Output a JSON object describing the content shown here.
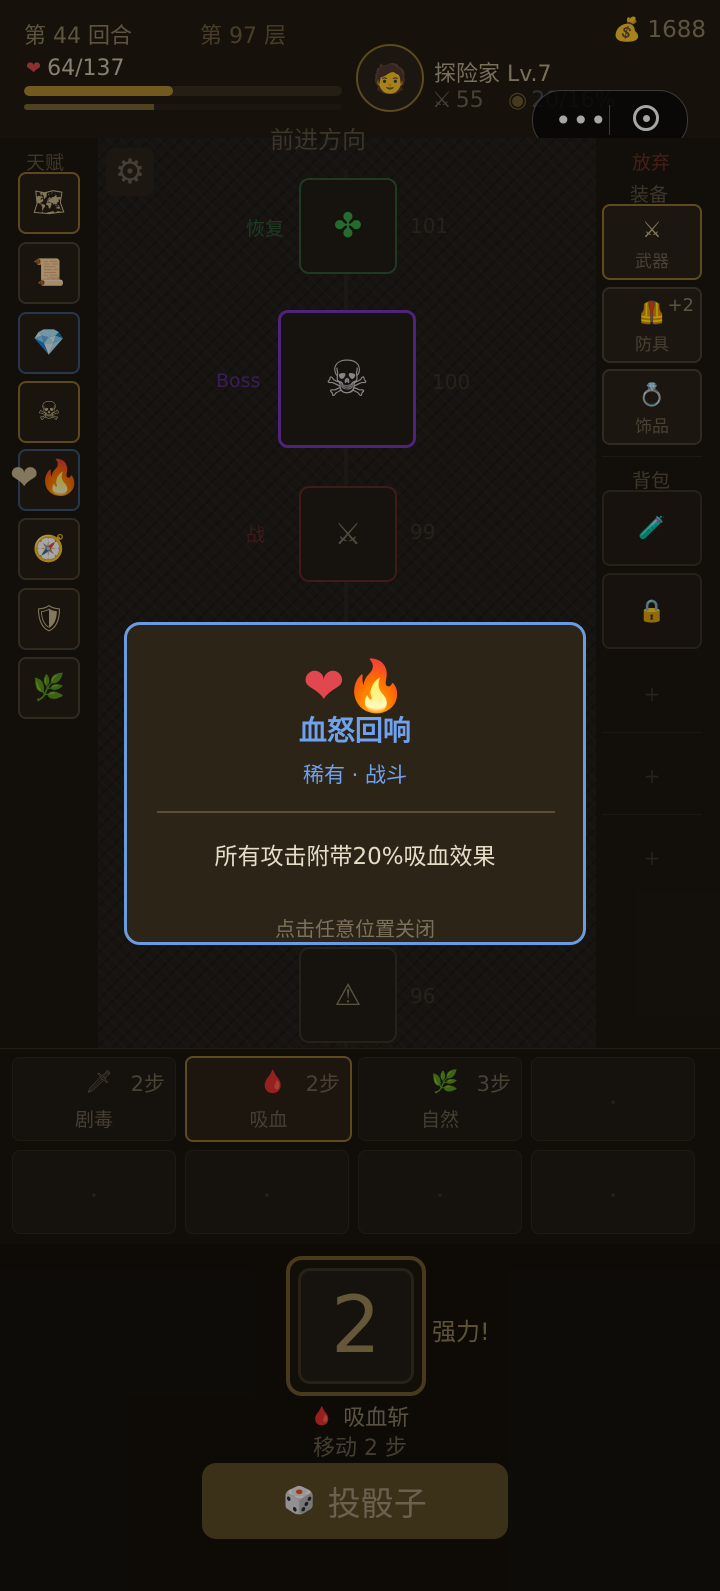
{
  "header": {
    "round": "第 44 回合",
    "floor": "第 97 层",
    "gold": "1688",
    "hp": "64/137",
    "hp_ratio": 0.467,
    "xp_ratio": 0.41,
    "player_name": "探险家 Lv.7",
    "attack": "55",
    "crit": "20/16%"
  },
  "board": {
    "direction_label": "前进方向",
    "tiles": [
      {
        "label": "恢复",
        "num": "101",
        "icon": "clover-icon",
        "glyph": "✤"
      },
      {
        "label": "Boss",
        "num": "100",
        "icon": "skull-icon",
        "glyph": "☠"
      },
      {
        "label": "战",
        "num": "99",
        "icon": "swords-icon",
        "glyph": "⚔"
      },
      {
        "label": "",
        "num": "96",
        "icon": "warning-icon",
        "glyph": "⚠"
      }
    ]
  },
  "sidebar_left": {
    "title": "天赋"
  },
  "sidebar_right": {
    "giveup": "放弃",
    "equip_title": "装备",
    "equipment": [
      {
        "name": "武器",
        "badge": ""
      },
      {
        "name": "防具",
        "badge": "+2"
      },
      {
        "name": "饰品",
        "badge": ""
      }
    ],
    "bag_title": "背包",
    "plus": "+"
  },
  "skills": [
    {
      "name": "剧毒",
      "steps": "2步"
    },
    {
      "name": "吸血",
      "steps": "2步"
    },
    {
      "name": "自然",
      "steps": "3步"
    }
  ],
  "dice": {
    "value": "2",
    "power_text": "强力!",
    "skill_name": "吸血斩",
    "move_text": "移动 2 步",
    "roll_label": "投骰子"
  },
  "modal": {
    "title": "血怒回响",
    "subtitle": "稀有 · 战斗",
    "description": "所有攻击附带20%吸血效果",
    "hint": "点击任意位置关闭"
  },
  "colors": {
    "accent_gold": "#8f7230",
    "modal_border": "#6b9be0",
    "rare_blue": "#6ea2ee",
    "boss_purple": "#8a3fd1"
  }
}
